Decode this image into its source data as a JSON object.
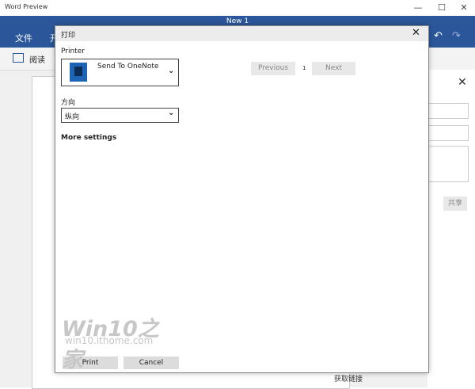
{
  "window": {
    "title": "Word Preview",
    "min": "—",
    "max": "☐",
    "close": "✕"
  },
  "ribbon": {
    "doc_title": "New 1",
    "file_tab": "文件",
    "next_tab": "开",
    "undo": "↶",
    "redo": "↷"
  },
  "toolbar": {
    "read_label": "阅读"
  },
  "share_panel": {
    "close": "✕",
    "share_button": "共享",
    "bottom_link": "获取链接"
  },
  "dialog": {
    "title": "打印",
    "close": "✕",
    "printer_label": "Printer",
    "printer_value": "Send To OneNote",
    "orientation_label": "方向",
    "orientation_value": "纵向",
    "more_settings": "More settings",
    "previous": "Previous",
    "page_number": "1",
    "next": "Next",
    "print": "Print",
    "cancel": "Cancel",
    "chevron": "⌄"
  },
  "watermark": {
    "brand": "Win10之家",
    "url": "win10.ithome.com"
  },
  "colors": {
    "ribbon": "#2b579a",
    "printer_icon": "#1e64b4"
  }
}
